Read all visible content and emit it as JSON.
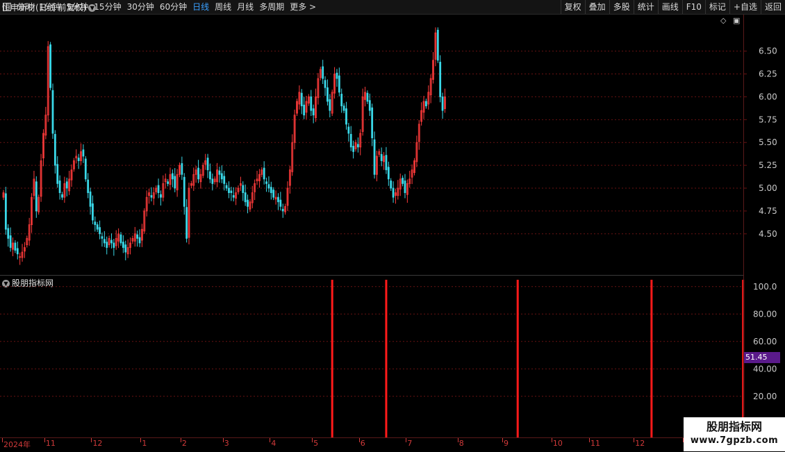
{
  "toolbar": {
    "periods": [
      "分时",
      "1分钟",
      "5分钟",
      "15分钟",
      "30分钟",
      "60分钟",
      "日线",
      "周线",
      "月线",
      "多周期",
      "更多 >"
    ],
    "active_period": "日线",
    "actions": [
      "复权",
      "叠加",
      "多股",
      "统计",
      "画线",
      "F10",
      "标记",
      "+自选",
      "返回"
    ]
  },
  "stock": {
    "title": "恒申新材(日线 前复权)"
  },
  "price_axis": {
    "ticks": [
      "6.50",
      "6.25",
      "6.00",
      "5.75",
      "5.50",
      "5.25",
      "5.00",
      "4.75",
      "4.50"
    ],
    "tick_values": [
      6.5,
      6.25,
      6.0,
      5.75,
      5.5,
      5.25,
      5.0,
      4.75,
      4.5
    ],
    "range": [
      4.05,
      6.9
    ]
  },
  "indicator": {
    "title": "股朋指标网",
    "axis_ticks": [
      "100.0",
      "80.00",
      "60.00",
      "40.00",
      "20.00"
    ],
    "axis_values": [
      100,
      80,
      60,
      40,
      20
    ],
    "range": [
      -10,
      108
    ],
    "current_value": "51.45",
    "signal_value": 105,
    "signal_indices": [
      140,
      163,
      219,
      276,
      315
    ]
  },
  "date_axis": {
    "labels": [
      "2024年",
      "11",
      "12",
      "1",
      "2",
      "3",
      "4",
      "5",
      "6",
      "7",
      "8",
      "9",
      "10",
      "11",
      "12",
      "1"
    ],
    "label_indices": [
      0,
      18,
      38,
      59,
      76,
      94,
      114,
      132,
      152,
      172,
      194,
      213,
      234,
      250,
      269,
      290
    ]
  },
  "colors": {
    "up": "#ff3b3b",
    "down": "#3ad8e8",
    "grid": "#6a1212",
    "signal": "#ff1a1a",
    "axis_text": "#d23a3a"
  },
  "watermark": {
    "title": "股朋指标网",
    "url": "www.7gpzb.com"
  },
  "chart_data": {
    "type": "candlestick",
    "title": "",
    "note": "daily OHLC, approximate",
    "closes": [
      4.95,
      4.55,
      4.45,
      4.35,
      4.4,
      4.32,
      4.28,
      4.25,
      4.3,
      4.35,
      4.45,
      4.6,
      4.9,
      5.1,
      4.75,
      4.9,
      5.3,
      5.6,
      5.8,
      6.55,
      6.1,
      5.6,
      5.25,
      5.05,
      4.95,
      4.9,
      5.05,
      5.0,
      5.1,
      5.2,
      5.3,
      5.35,
      5.3,
      5.4,
      5.35,
      5.1,
      4.95,
      4.8,
      4.65,
      4.6,
      4.55,
      4.5,
      4.45,
      4.4,
      4.35,
      4.45,
      4.4,
      4.35,
      4.45,
      4.5,
      4.4,
      4.35,
      4.3,
      4.35,
      4.4,
      4.45,
      4.5,
      4.45,
      4.4,
      4.55,
      4.75,
      4.9,
      4.95,
      4.9,
      4.95,
      5.0,
      4.95,
      4.9,
      5.05,
      5.1,
      5.05,
      5.15,
      5.1,
      5.0,
      5.15,
      5.25,
      5.15,
      4.8,
      4.45,
      5.0,
      5.05,
      5.15,
      5.2,
      5.1,
      5.15,
      5.25,
      5.3,
      5.2,
      5.1,
      5.05,
      5.1,
      5.2,
      5.15,
      5.1,
      5.05,
      5.0,
      4.95,
      4.95,
      4.9,
      4.95,
      5.0,
      5.05,
      4.95,
      4.85,
      4.8,
      4.85,
      4.95,
      5.05,
      5.1,
      5.15,
      5.2,
      5.1,
      5.05,
      5.0,
      4.95,
      4.9,
      4.9,
      4.85,
      4.8,
      4.75,
      4.8,
      5.0,
      5.2,
      5.5,
      5.8,
      5.95,
      6.05,
      5.9,
      5.8,
      5.95,
      6.0,
      5.85,
      5.8,
      6.0,
      6.2,
      6.3,
      6.2,
      6.1,
      5.95,
      5.85,
      6.05,
      6.25,
      6.2,
      6.05,
      5.9,
      5.85,
      5.7,
      5.6,
      5.45,
      5.4,
      5.5,
      5.45,
      5.6,
      6.0,
      6.05,
      5.95,
      5.85,
      5.55,
      5.15,
      5.35,
      5.4,
      5.3,
      5.35,
      5.2,
      5.1,
      5.0,
      4.9,
      4.95,
      5.0,
      5.1,
      5.05,
      4.95,
      5.05,
      5.1,
      5.2,
      5.3,
      5.5,
      5.7,
      5.85,
      5.95,
      5.9,
      6.05,
      6.2,
      6.4,
      6.7,
      6.4,
      6.0,
      5.85,
      6.0
    ]
  }
}
